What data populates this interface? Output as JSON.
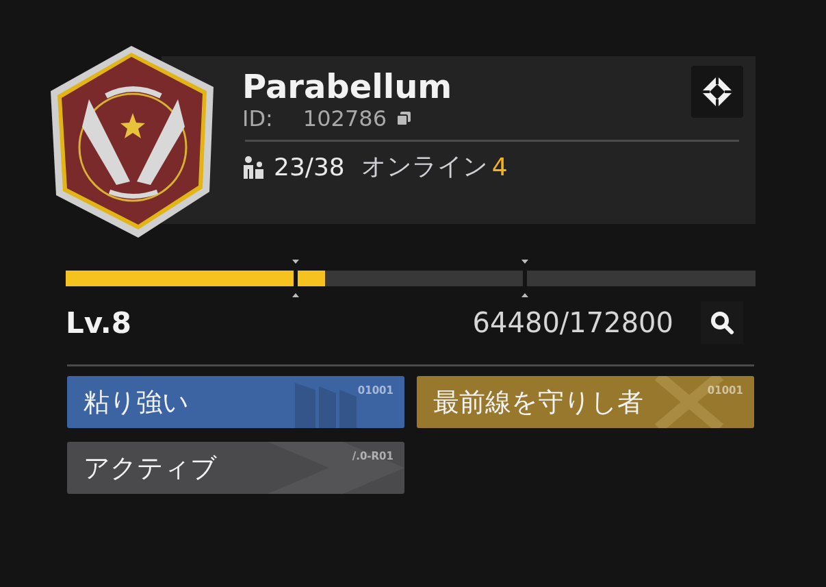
{
  "clan": {
    "name": "Parabellum",
    "id_label": "ID:",
    "id": "102786",
    "members": "23/38",
    "online_label": "オンライン",
    "online_count": "4"
  },
  "progress": {
    "level": 0.376,
    "level_label": "Lv.8",
    "exp": "64480/172800"
  },
  "tags": [
    {
      "label": "粘り強い",
      "code": "01001",
      "color": "#3d64a2",
      "kind": "stripes"
    },
    {
      "label": "最前線を守りし者",
      "code": "01001",
      "color": "#97782c",
      "kind": "cross"
    },
    {
      "label": "アクティブ",
      "code": "/.0-R01",
      "color": "#4a4a4d",
      "kind": "chevron"
    }
  ]
}
